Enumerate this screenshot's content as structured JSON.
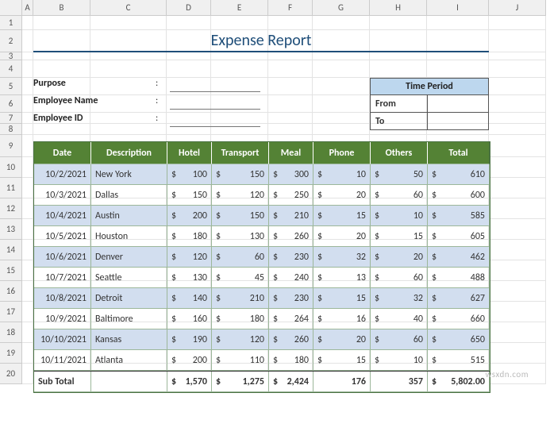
{
  "columns": [
    "A",
    "B",
    "C",
    "D",
    "E",
    "F",
    "G",
    "H",
    "I",
    "J"
  ],
  "rowcount": 20,
  "title": "Expense Report",
  "form": {
    "purpose_label": "Purpose",
    "employee_name_label": "Employee Name",
    "employee_id_label": "Employee ID",
    "colon": ":"
  },
  "time_period": {
    "header": "Time Period",
    "from_label": "From",
    "to_label": "To",
    "from_value": "",
    "to_value": ""
  },
  "table": {
    "headers": {
      "date": "Date",
      "description": "Description",
      "hotel": "Hotel",
      "transport": "Transport",
      "meal": "Meal",
      "phone": "Phone",
      "others": "Others",
      "total": "Total"
    },
    "currency": "$",
    "rows": [
      {
        "date": "10/2/2021",
        "desc": "New York",
        "hotel": "100",
        "transport": "150",
        "meal": "300",
        "phone": "10",
        "others": "50",
        "total": "610"
      },
      {
        "date": "10/3/2021",
        "desc": "Dallas",
        "hotel": "150",
        "transport": "120",
        "meal": "250",
        "phone": "20",
        "others": "60",
        "total": "600"
      },
      {
        "date": "10/4/2021",
        "desc": "Austin",
        "hotel": "200",
        "transport": "150",
        "meal": "210",
        "phone": "15",
        "others": "10",
        "total": "585"
      },
      {
        "date": "10/5/2021",
        "desc": "Houston",
        "hotel": "180",
        "transport": "130",
        "meal": "260",
        "phone": "20",
        "others": "15",
        "total": "605"
      },
      {
        "date": "10/6/2021",
        "desc": "Denver",
        "hotel": "120",
        "transport": "60",
        "meal": "230",
        "phone": "32",
        "others": "20",
        "total": "462"
      },
      {
        "date": "10/7/2021",
        "desc": "Seattle",
        "hotel": "130",
        "transport": "45",
        "meal": "240",
        "phone": "13",
        "others": "60",
        "total": "488"
      },
      {
        "date": "10/8/2021",
        "desc": "Detroit",
        "hotel": "140",
        "transport": "210",
        "meal": "230",
        "phone": "15",
        "others": "32",
        "total": "627"
      },
      {
        "date": "10/9/2021",
        "desc": "Baltimore",
        "hotel": "160",
        "transport": "180",
        "meal": "264",
        "phone": "16",
        "others": "40",
        "total": "660"
      },
      {
        "date": "10/10/2021",
        "desc": "Kansas",
        "hotel": "190",
        "transport": "120",
        "meal": "260",
        "phone": "20",
        "others": "60",
        "total": "650"
      },
      {
        "date": "10/11/2021",
        "desc": "Atlanta",
        "hotel": "200",
        "transport": "110",
        "meal": "180",
        "phone": "15",
        "others": "10",
        "total": "515"
      }
    ],
    "subtotal": {
      "label": "Sub Total",
      "hotel": "1,570",
      "transport": "1,275",
      "meal": "2,424",
      "phone": "176",
      "others": "357",
      "total": "5,802.00"
    }
  },
  "watermark": "wsxdn.com"
}
